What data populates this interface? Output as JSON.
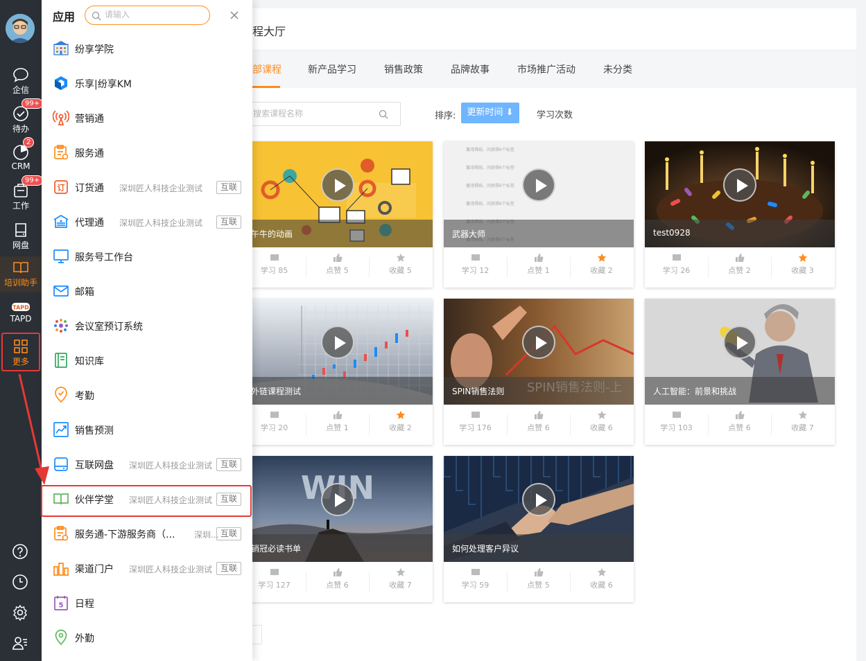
{
  "rail": {
    "items": [
      {
        "label": "企信",
        "icon": "chat-icon"
      },
      {
        "label": "待办",
        "icon": "check-circle-icon",
        "badge": "99+"
      },
      {
        "label": "CRM",
        "icon": "crm-icon",
        "badge": "2"
      },
      {
        "label": "工作",
        "icon": "work-icon",
        "badge": "99+"
      },
      {
        "label": "网盘",
        "icon": "disk-icon"
      },
      {
        "label": "培训助手",
        "icon": "book-icon"
      },
      {
        "label": "TAPD",
        "icon": "tapd-logo-icon",
        "logo_text": "TAPD"
      },
      {
        "label": "更多",
        "icon": "grid-icon"
      }
    ],
    "bottom_icons": [
      "help-icon",
      "clock-icon",
      "gear-icon",
      "contacts-icon"
    ]
  },
  "drawer": {
    "title": "应用",
    "search_placeholder": "请输入",
    "apps": [
      {
        "name": "纷享学院",
        "org": "",
        "tag": "",
        "icon": "academy-icon",
        "color": "#3b7ddd"
      },
      {
        "name": "乐享|纷享KM",
        "org": "",
        "tag": "",
        "icon": "km-icon",
        "color": "#1a8cff"
      },
      {
        "name": "营销通",
        "org": "",
        "tag": "",
        "icon": "broadcast-icon",
        "color": "#f05a28"
      },
      {
        "name": "服务通",
        "org": "",
        "tag": "",
        "icon": "service-icon",
        "color": "#ff8c1a"
      },
      {
        "name": "订货通",
        "org": "深圳匠人科技企业测试",
        "tag": "互联",
        "icon": "order-icon",
        "color": "#f05a28"
      },
      {
        "name": "代理通",
        "org": "深圳匠人科技企业测试",
        "tag": "互联",
        "icon": "agent-icon",
        "color": "#1a8cff"
      },
      {
        "name": "服务号工作台",
        "org": "",
        "tag": "",
        "icon": "monitor-icon",
        "color": "#1a8cff"
      },
      {
        "name": "邮箱",
        "org": "",
        "tag": "",
        "icon": "mail-icon",
        "color": "#1a8cff"
      },
      {
        "name": "会议室预订系统",
        "org": "",
        "tag": "",
        "icon": "meeting-icon",
        "color": "#9b59b6"
      },
      {
        "name": "知识库",
        "org": "",
        "tag": "",
        "icon": "knowledge-icon",
        "color": "#2eaa5c"
      },
      {
        "name": "考勤",
        "org": "",
        "tag": "",
        "icon": "attendance-icon",
        "color": "#ff8c1a"
      },
      {
        "name": "销售预测",
        "org": "",
        "tag": "",
        "icon": "forecast-icon",
        "color": "#1a8cff"
      },
      {
        "name": "互联网盘",
        "org": "深圳匠人科技企业测试",
        "tag": "互联",
        "icon": "netdisk-icon",
        "color": "#1a8cff"
      },
      {
        "name": "伙伴学堂",
        "org": "深圳匠人科技企业测试",
        "tag": "互联",
        "icon": "open-book-icon",
        "color": "#5cb85c"
      },
      {
        "name": "服务通-下游服务商（...",
        "org": "深圳...",
        "tag": "互联",
        "icon": "service-icon",
        "color": "#ff8c1a"
      },
      {
        "name": "渠道门户",
        "org": "深圳匠人科技企业测试",
        "tag": "互联",
        "icon": "channel-icon",
        "color": "#ff8c1a"
      },
      {
        "name": "日程",
        "org": "",
        "tag": "",
        "icon": "calendar-icon",
        "color": "#9b59b6",
        "glyph": "5"
      },
      {
        "name": "外勤",
        "org": "",
        "tag": "",
        "icon": "location-icon",
        "color": "#5cb85c"
      }
    ]
  },
  "main": {
    "title": "程大厅",
    "tabs": [
      "部课程",
      "新产品学习",
      "销售政策",
      "品牌故事",
      "市场推广活动",
      "未分类"
    ],
    "search_placeholder": "搜索课程名称",
    "sort_label": "排序:",
    "sort_active": "更新时间 ⬇",
    "sort_other": "学习次数",
    "courses": [
      {
        "title": "午牛的动画",
        "study": "学习 85",
        "like": "点赞 5",
        "fav": "收藏 5",
        "fav_on": false
      },
      {
        "title": "武器大师",
        "study": "学习 12",
        "like": "点赞 1",
        "fav": "收藏 2",
        "fav_on": true
      },
      {
        "title": "test0928",
        "study": "学习 26",
        "like": "点赞 2",
        "fav": "收藏 3",
        "fav_on": true
      },
      {
        "title": "外链课程测试",
        "study": "学习 20",
        "like": "点赞 1",
        "fav": "收藏 2",
        "fav_on": true
      },
      {
        "title": "SPIN销售法则",
        "study": "学习 176",
        "like": "点赞 6",
        "fav": "收藏 6",
        "fav_on": false,
        "overlay": "SPIN销售法则-上"
      },
      {
        "title": "人工智能：前景和挑战",
        "study": "学习 103",
        "like": "点赞 6",
        "fav": "收藏 7",
        "fav_on": false
      },
      {
        "title": "销冠必读书单",
        "study": "学习 127",
        "like": "点赞 6",
        "fav": "收藏 7",
        "fav_on": false,
        "overlay": "WIN"
      },
      {
        "title": "如何处理客户异议",
        "study": "学习 59",
        "like": "点赞 5",
        "fav": "收藏 6",
        "fav_on": false
      }
    ],
    "card2_lines": [
      "莆湾得线、问南得6个标签",
      "莆湾得线、问南得6个标签",
      "莆湾得线、问南得6个标签",
      "莆湾得线、问南得6个标签",
      "莆湾得线、问南得6个标签",
      "莆湾得线、问南得6个标签"
    ]
  },
  "colors": {
    "accent": "#ff8c1a",
    "highlight": "#e53935",
    "sort_button": "#6fb6ff",
    "rail": "#2b2f36"
  }
}
